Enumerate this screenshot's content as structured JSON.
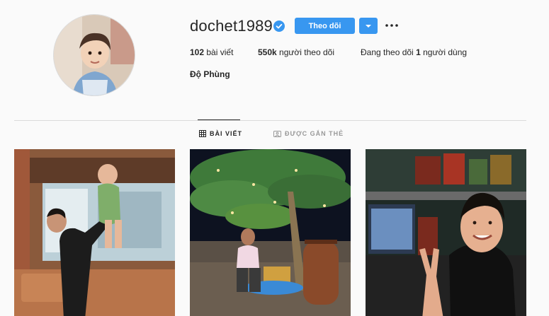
{
  "profile": {
    "username": "dochet1989",
    "full_name": "Độ Phùng",
    "verified": true,
    "avatar_icon": "child-portrait-avatar"
  },
  "actions": {
    "follow_label": "Theo dõi",
    "dropdown_icon": "caret-down-icon",
    "more_icon": "more-options-icon"
  },
  "stats": {
    "posts_count": "102",
    "posts_label": "bài viết",
    "followers_count": "550k",
    "followers_label": "người theo dõi",
    "following_prefix": "Đang theo dõi",
    "following_count": "1",
    "following_label": "người dùng"
  },
  "tabs": [
    {
      "label": "BÀI VIẾT",
      "icon": "grid-icon",
      "active": true
    },
    {
      "label": "ĐƯỢC GẮN THẺ",
      "icon": "tag-icon",
      "active": false
    }
  ],
  "posts": [
    {
      "description_icon": "photo-man-lifting-child"
    },
    {
      "description_icon": "photo-man-sitting-under-tree-night"
    },
    {
      "description_icon": "photo-selfie-gaming-room"
    }
  ],
  "colors": {
    "accent": "#3897f0",
    "verified": "#3897f0",
    "background": "#fafafa",
    "text": "#262626",
    "muted": "#999999"
  }
}
